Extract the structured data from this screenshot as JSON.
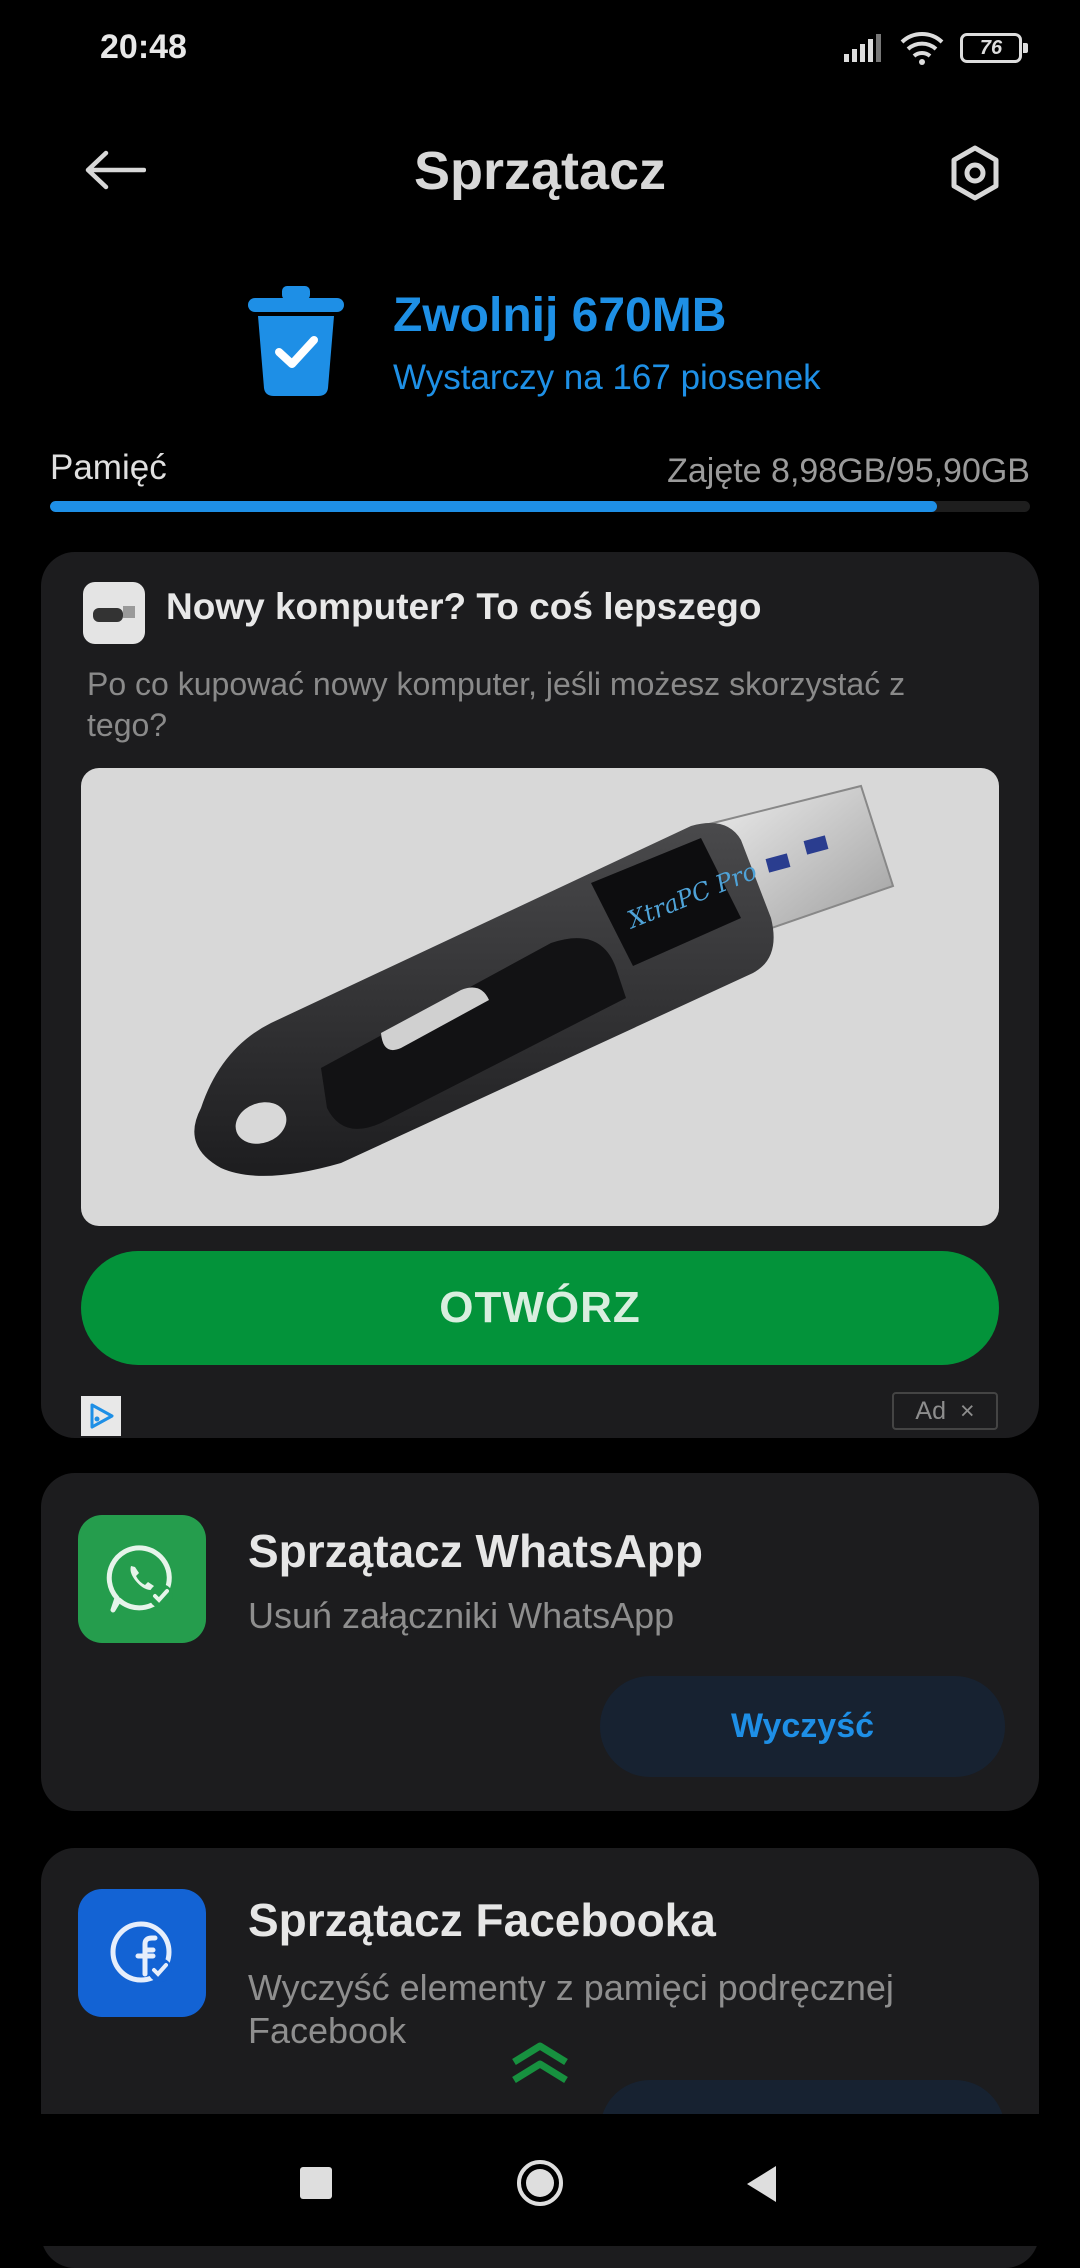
{
  "status_bar": {
    "time": "20:48",
    "battery": "76"
  },
  "header": {
    "title": "Sprzątacz"
  },
  "summary": {
    "free_title": "Zwolnij 670MB",
    "free_subtitle": "Wystarczy na 167 piosenek"
  },
  "storage": {
    "label": "Pamięć",
    "value": "Zajęte 8,98GB/95,90GB",
    "bar_fill_fraction": 0.905
  },
  "ad": {
    "title": "Nowy komputer? To coś lepszego",
    "description": "Po co kupować nowy komputer, jeśli możesz skorzystać z tego?",
    "image_brand_text": "XtraPC Pro",
    "cta_label": "OTWÓRZ",
    "badge_label": "Ad",
    "close_glyph": "×"
  },
  "cleaners": [
    {
      "title": "Sprzątacz WhatsApp",
      "subtitle": "Usuń załączniki WhatsApp",
      "button_label": "Wyczyść",
      "icon": "whatsapp-icon",
      "color": "#259d4d"
    },
    {
      "title": "Sprzątacz Facebooka",
      "subtitle": "Wyczyść elementy z pamięci podręcznej Facebook",
      "button_label": "",
      "icon": "facebook-icon",
      "color": "#1363d4"
    }
  ],
  "colors": {
    "accent": "#1e8fe6",
    "cta_green": "#03933a",
    "card_bg": "#1c1c1e"
  }
}
